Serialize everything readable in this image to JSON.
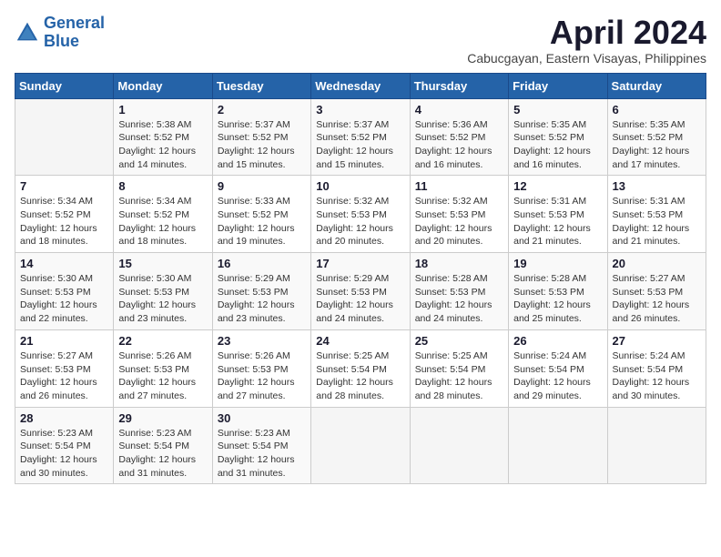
{
  "logo": {
    "text_general": "General",
    "text_blue": "Blue"
  },
  "title": "April 2024",
  "subtitle": "Cabucgayan, Eastern Visayas, Philippines",
  "weekdays": [
    "Sunday",
    "Monday",
    "Tuesday",
    "Wednesday",
    "Thursday",
    "Friday",
    "Saturday"
  ],
  "weeks": [
    [
      {
        "day": "",
        "info": ""
      },
      {
        "day": "1",
        "info": "Sunrise: 5:38 AM\nSunset: 5:52 PM\nDaylight: 12 hours\nand 14 minutes."
      },
      {
        "day": "2",
        "info": "Sunrise: 5:37 AM\nSunset: 5:52 PM\nDaylight: 12 hours\nand 15 minutes."
      },
      {
        "day": "3",
        "info": "Sunrise: 5:37 AM\nSunset: 5:52 PM\nDaylight: 12 hours\nand 15 minutes."
      },
      {
        "day": "4",
        "info": "Sunrise: 5:36 AM\nSunset: 5:52 PM\nDaylight: 12 hours\nand 16 minutes."
      },
      {
        "day": "5",
        "info": "Sunrise: 5:35 AM\nSunset: 5:52 PM\nDaylight: 12 hours\nand 16 minutes."
      },
      {
        "day": "6",
        "info": "Sunrise: 5:35 AM\nSunset: 5:52 PM\nDaylight: 12 hours\nand 17 minutes."
      }
    ],
    [
      {
        "day": "7",
        "info": "Sunrise: 5:34 AM\nSunset: 5:52 PM\nDaylight: 12 hours\nand 18 minutes."
      },
      {
        "day": "8",
        "info": "Sunrise: 5:34 AM\nSunset: 5:52 PM\nDaylight: 12 hours\nand 18 minutes."
      },
      {
        "day": "9",
        "info": "Sunrise: 5:33 AM\nSunset: 5:52 PM\nDaylight: 12 hours\nand 19 minutes."
      },
      {
        "day": "10",
        "info": "Sunrise: 5:32 AM\nSunset: 5:53 PM\nDaylight: 12 hours\nand 20 minutes."
      },
      {
        "day": "11",
        "info": "Sunrise: 5:32 AM\nSunset: 5:53 PM\nDaylight: 12 hours\nand 20 minutes."
      },
      {
        "day": "12",
        "info": "Sunrise: 5:31 AM\nSunset: 5:53 PM\nDaylight: 12 hours\nand 21 minutes."
      },
      {
        "day": "13",
        "info": "Sunrise: 5:31 AM\nSunset: 5:53 PM\nDaylight: 12 hours\nand 21 minutes."
      }
    ],
    [
      {
        "day": "14",
        "info": "Sunrise: 5:30 AM\nSunset: 5:53 PM\nDaylight: 12 hours\nand 22 minutes."
      },
      {
        "day": "15",
        "info": "Sunrise: 5:30 AM\nSunset: 5:53 PM\nDaylight: 12 hours\nand 23 minutes."
      },
      {
        "day": "16",
        "info": "Sunrise: 5:29 AM\nSunset: 5:53 PM\nDaylight: 12 hours\nand 23 minutes."
      },
      {
        "day": "17",
        "info": "Sunrise: 5:29 AM\nSunset: 5:53 PM\nDaylight: 12 hours\nand 24 minutes."
      },
      {
        "day": "18",
        "info": "Sunrise: 5:28 AM\nSunset: 5:53 PM\nDaylight: 12 hours\nand 24 minutes."
      },
      {
        "day": "19",
        "info": "Sunrise: 5:28 AM\nSunset: 5:53 PM\nDaylight: 12 hours\nand 25 minutes."
      },
      {
        "day": "20",
        "info": "Sunrise: 5:27 AM\nSunset: 5:53 PM\nDaylight: 12 hours\nand 26 minutes."
      }
    ],
    [
      {
        "day": "21",
        "info": "Sunrise: 5:27 AM\nSunset: 5:53 PM\nDaylight: 12 hours\nand 26 minutes."
      },
      {
        "day": "22",
        "info": "Sunrise: 5:26 AM\nSunset: 5:53 PM\nDaylight: 12 hours\nand 27 minutes."
      },
      {
        "day": "23",
        "info": "Sunrise: 5:26 AM\nSunset: 5:53 PM\nDaylight: 12 hours\nand 27 minutes."
      },
      {
        "day": "24",
        "info": "Sunrise: 5:25 AM\nSunset: 5:54 PM\nDaylight: 12 hours\nand 28 minutes."
      },
      {
        "day": "25",
        "info": "Sunrise: 5:25 AM\nSunset: 5:54 PM\nDaylight: 12 hours\nand 28 minutes."
      },
      {
        "day": "26",
        "info": "Sunrise: 5:24 AM\nSunset: 5:54 PM\nDaylight: 12 hours\nand 29 minutes."
      },
      {
        "day": "27",
        "info": "Sunrise: 5:24 AM\nSunset: 5:54 PM\nDaylight: 12 hours\nand 30 minutes."
      }
    ],
    [
      {
        "day": "28",
        "info": "Sunrise: 5:23 AM\nSunset: 5:54 PM\nDaylight: 12 hours\nand 30 minutes."
      },
      {
        "day": "29",
        "info": "Sunrise: 5:23 AM\nSunset: 5:54 PM\nDaylight: 12 hours\nand 31 minutes."
      },
      {
        "day": "30",
        "info": "Sunrise: 5:23 AM\nSunset: 5:54 PM\nDaylight: 12 hours\nand 31 minutes."
      },
      {
        "day": "",
        "info": ""
      },
      {
        "day": "",
        "info": ""
      },
      {
        "day": "",
        "info": ""
      },
      {
        "day": "",
        "info": ""
      }
    ]
  ]
}
